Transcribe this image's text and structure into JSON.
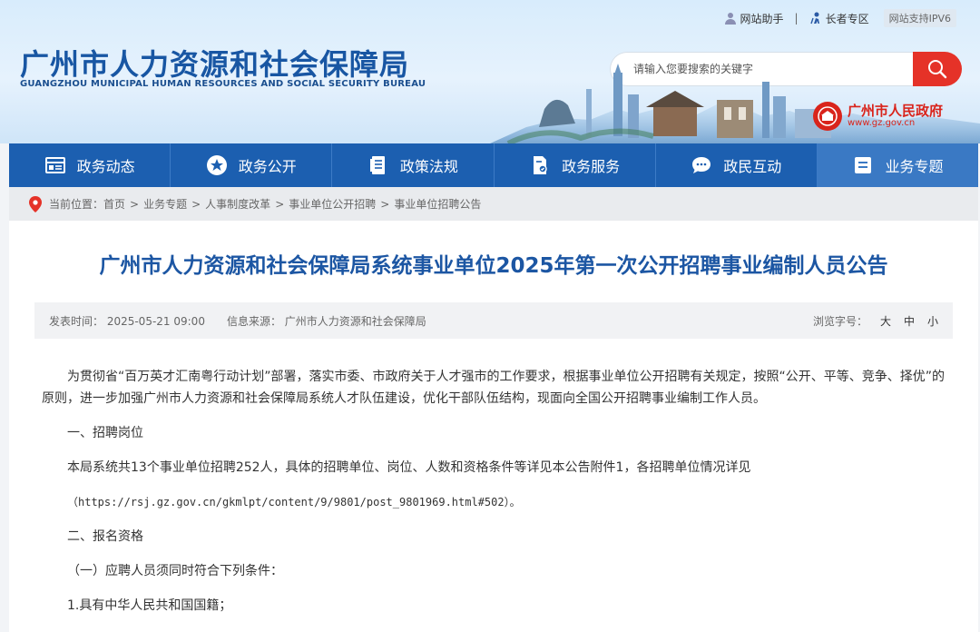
{
  "top_links": {
    "assistant": "网站助手",
    "sep": "|",
    "elder": "长者专区",
    "ipv6": "网站支持IPV6"
  },
  "logo": {
    "cn": "广州市人力资源和社会保障局",
    "en": "GUANGZHOU MUNICIPAL HUMAN RESOURCES AND SOCIAL SECURITY BUREAU"
  },
  "search": {
    "placeholder": "请输入您要搜索的关键字"
  },
  "gov": {
    "cn": "广州市人民政府",
    "url": "www.gz.gov.cn"
  },
  "nav": [
    {
      "label": "政务动态",
      "icon": "news-icon"
    },
    {
      "label": "政务公开",
      "icon": "star-icon"
    },
    {
      "label": "政策法规",
      "icon": "document-icon"
    },
    {
      "label": "政务服务",
      "icon": "service-icon"
    },
    {
      "label": "政民互动",
      "icon": "chat-icon"
    },
    {
      "label": "业务专题",
      "icon": "topic-icon"
    }
  ],
  "breadcrumb": {
    "prefix": "当前位置：",
    "items": [
      "首页",
      "业务专题",
      "人事制度改革",
      "事业单位公开招聘",
      "事业单位招聘公告"
    ]
  },
  "article": {
    "title": "广州市人力资源和社会保障局系统事业单位2025年第一次公开招聘事业编制人员公告",
    "publish_time": "发表时间： 2025-05-21 09:00",
    "source": "信息来源： 广州市人力资源和社会保障局",
    "font_size_label": "浏览字号：",
    "font_sizes": [
      "大",
      "中",
      "小"
    ],
    "paragraphs": {
      "intro": "为贯彻省“百万英才汇南粤行动计划”部署，落实市委、市政府关于人才强市的工作要求，根据事业单位公开招聘有关规定，按照“公开、平等、竞争、择优”的原则，进一步加强广州市人力资源和社会保障局系统人才队伍建设，优化干部队伍结构，现面向全国公开招聘事业编制工作人员。",
      "section1": "一、招聘岗位",
      "section1_text": "本局系统共13个事业单位招聘252人，具体的招聘单位、岗位、人数和资格条件等详见本公告附件1，各招聘单位情况详见",
      "url": "（https://rsj.gz.gov.cn/gkmlpt/content/9/9801/post_9801969.html#502）。",
      "section2": "二、报名资格",
      "sub1": "（一）应聘人员须同时符合下列条件：",
      "item1": "1.具有中华人民共和国国籍；"
    }
  },
  "colors": {
    "nav": "#1c5fb0",
    "title": "#1c56a3",
    "search_button": "#e53228",
    "gov_red": "#d9241b"
  }
}
